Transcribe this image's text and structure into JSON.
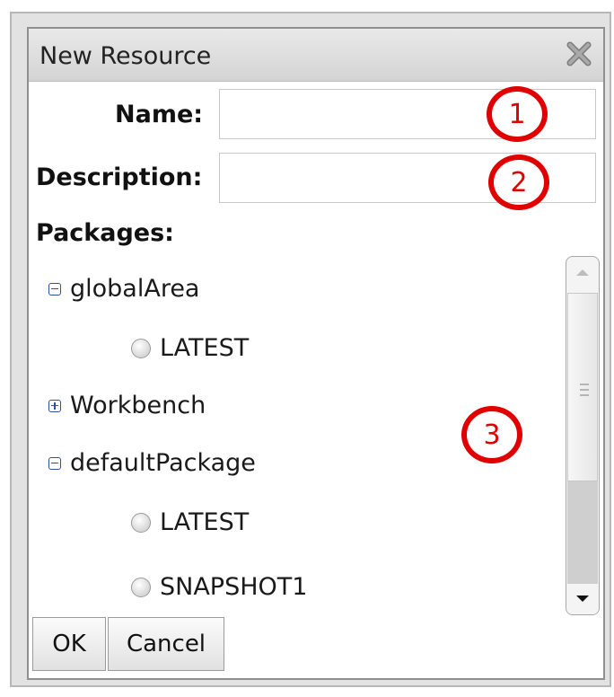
{
  "dialog": {
    "title": "New Resource",
    "close_icon": "close-x-icon"
  },
  "form": {
    "name_label": "Name:",
    "name_value": "",
    "description_label": "Description:",
    "description_value": "",
    "packages_label": "Packages:"
  },
  "packages": [
    {
      "label": "globalArea",
      "expanded": true,
      "children": [
        "LATEST"
      ]
    },
    {
      "label": "Workbench",
      "expanded": false,
      "children": []
    },
    {
      "label": "defaultPackage",
      "expanded": true,
      "children": [
        "LATEST",
        "SNAPSHOT1"
      ]
    }
  ],
  "markers": [
    "1",
    "2",
    "3"
  ],
  "buttons": {
    "ok": "OK",
    "cancel": "Cancel"
  },
  "colors": {
    "marker": "#e00000",
    "expander": "#2b4fa8"
  }
}
